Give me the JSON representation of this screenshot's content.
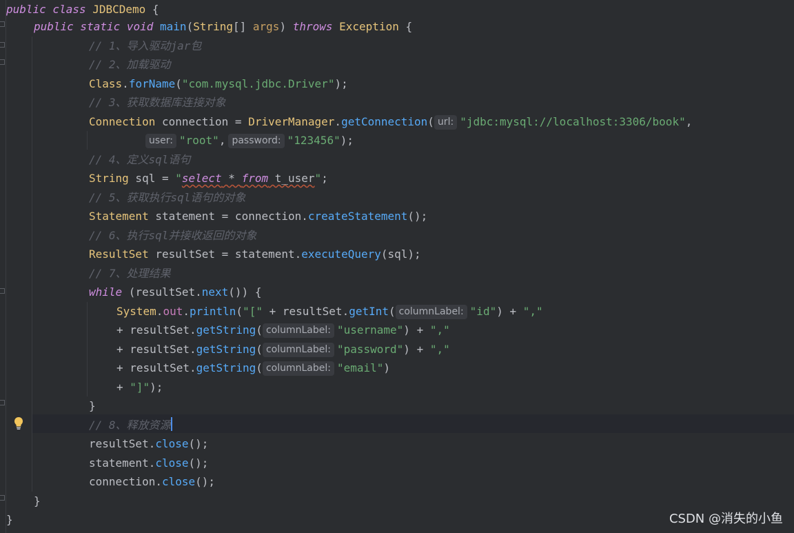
{
  "code": {
    "l01_kw": "public class ",
    "l01_cls": "JDBCDemo",
    "l01_rest": " {",
    "l02_kw": "public static void ",
    "l02_fn": "main",
    "l02_p1": "(",
    "l02_cls1": "String",
    "l02_p2": "[] ",
    "l02_arg": "args",
    "l02_p3": ") ",
    "l02_kw2": "throws ",
    "l02_cls2": "Exception",
    "l02_p4": " {",
    "c1": "// 1、导入驱动jar包",
    "c2": "// 2、加载驱动",
    "l05_cls": "Class",
    "l05_dot": ".",
    "l05_fn": "forName",
    "l05_p1": "(",
    "l05_str": "\"com.mysql.jdbc.Driver\"",
    "l05_p2": ");",
    "c3": "// 3、获取数据库连接对象",
    "l07_cls1": "Connection",
    "l07_var": " connection = ",
    "l07_cls2": "DriverManager",
    "l07_dot": ".",
    "l07_fn": "getConnection",
    "l07_p1": "(",
    "hint_url": "url:",
    "l07_str": "\"jdbc:mysql://localhost:3306/book\"",
    "l07_p2": ",",
    "hint_user": "user:",
    "l08_str1": "\"root\"",
    "l08_p1": ",",
    "hint_password": "password:",
    "l08_str2": "\"123456\"",
    "l08_p2": ");",
    "c4": "// 4、定义sql语句",
    "l10_cls": "String",
    "l10_var": " sql = ",
    "l10_q1": "\"",
    "l10_sel": "select",
    "l10_star": " * ",
    "l10_from": "from",
    "l10_tbl": " t_user",
    "l10_q2": "\"",
    "l10_end": ";",
    "c5": "// 5、获取执行sql语句的对象",
    "l12_cls": "Statement",
    "l12_var": " statement = connection.",
    "l12_fn": "createStatement",
    "l12_end": "();",
    "c6": "// 6、执行sql并接收返回的对象",
    "l14_cls": "ResultSet",
    "l14_var": " resultSet = statement.",
    "l14_fn": "executeQuery",
    "l14_end": "(sql);",
    "c7": "// 7、处理结果",
    "l16_kw": "while",
    "l16_p1": " (resultSet.",
    "l16_fn": "next",
    "l16_p2": "()) {",
    "l17_cls": "System",
    "l17_dot1": ".",
    "l17_fld": "out",
    "l17_dot2": ".",
    "l17_fn": "println",
    "l17_p1": "(",
    "l17_str1": "\"[\"",
    "l17_p2": " + resultSet.",
    "l17_fn2": "getInt",
    "l17_p3": "(",
    "hint_col1": "columnLabel:",
    "l17_str2": "\"id\"",
    "l17_p4": ") + ",
    "l17_str3": "\",\"",
    "l18_p1": "+ resultSet.",
    "l18_fn": "getString",
    "l18_p2": "(",
    "hint_col2": "columnLabel:",
    "l18_str1": "\"username\"",
    "l18_p3": ") + ",
    "l18_str2": "\",\"",
    "l19_p1": "+ resultSet.",
    "l19_fn": "getString",
    "l19_p2": "(",
    "hint_col3": "columnLabel:",
    "l19_str1": "\"password\"",
    "l19_p3": ") + ",
    "l19_str2": "\",\"",
    "l20_p1": "+ resultSet.",
    "l20_fn": "getString",
    "l20_p2": "(",
    "hint_col4": "columnLabel:",
    "l20_str": "\"email\"",
    "l20_p3": ")",
    "l21_p1": "+ ",
    "l21_str": "\"]\"",
    "l21_p2": ");",
    "l22": "}",
    "c8": "// 8、释放资源",
    "l24_var": "resultSet.",
    "l24_fn": "close",
    "l24_end": "();",
    "l25_var": "statement.",
    "l25_fn": "close",
    "l25_end": "();",
    "l26_var": "connection.",
    "l26_fn": "close",
    "l26_end": "();",
    "l27": "}",
    "l28": "}"
  },
  "watermark": "CSDN @消失的小鱼",
  "colors": {
    "background": "#2b2d30",
    "keyword": "#cf8ee0",
    "class": "#e6c47b",
    "method": "#57aaf7",
    "string": "#6aab73",
    "comment": "#5f626b"
  }
}
